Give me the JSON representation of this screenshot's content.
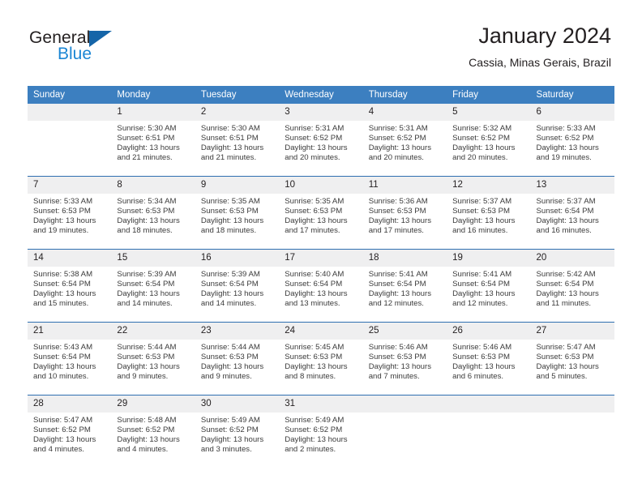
{
  "brand": {
    "name_part1": "General",
    "name_part2": "Blue",
    "triangle_color": "#1565a8",
    "blue_color": "#1b86d4"
  },
  "header": {
    "title": "January 2024",
    "subtitle": "Cassia, Minas Gerais, Brazil"
  },
  "theme": {
    "header_bar_color": "#3c7fc0",
    "row_divider_color": "#2f6fb0",
    "daynum_band_color": "#efeff0"
  },
  "calendar": {
    "weekday_headers": [
      "Sunday",
      "Monday",
      "Tuesday",
      "Wednesday",
      "Thursday",
      "Friday",
      "Saturday"
    ],
    "weeks": [
      [
        {
          "day": "",
          "sunrise": "",
          "sunset": "",
          "daylight_line1": "",
          "daylight_line2": ""
        },
        {
          "day": "1",
          "sunrise": "Sunrise: 5:30 AM",
          "sunset": "Sunset: 6:51 PM",
          "daylight_line1": "Daylight: 13 hours",
          "daylight_line2": "and 21 minutes."
        },
        {
          "day": "2",
          "sunrise": "Sunrise: 5:30 AM",
          "sunset": "Sunset: 6:51 PM",
          "daylight_line1": "Daylight: 13 hours",
          "daylight_line2": "and 21 minutes."
        },
        {
          "day": "3",
          "sunrise": "Sunrise: 5:31 AM",
          "sunset": "Sunset: 6:52 PM",
          "daylight_line1": "Daylight: 13 hours",
          "daylight_line2": "and 20 minutes."
        },
        {
          "day": "4",
          "sunrise": "Sunrise: 5:31 AM",
          "sunset": "Sunset: 6:52 PM",
          "daylight_line1": "Daylight: 13 hours",
          "daylight_line2": "and 20 minutes."
        },
        {
          "day": "5",
          "sunrise": "Sunrise: 5:32 AM",
          "sunset": "Sunset: 6:52 PM",
          "daylight_line1": "Daylight: 13 hours",
          "daylight_line2": "and 20 minutes."
        },
        {
          "day": "6",
          "sunrise": "Sunrise: 5:33 AM",
          "sunset": "Sunset: 6:52 PM",
          "daylight_line1": "Daylight: 13 hours",
          "daylight_line2": "and 19 minutes."
        }
      ],
      [
        {
          "day": "7",
          "sunrise": "Sunrise: 5:33 AM",
          "sunset": "Sunset: 6:53 PM",
          "daylight_line1": "Daylight: 13 hours",
          "daylight_line2": "and 19 minutes."
        },
        {
          "day": "8",
          "sunrise": "Sunrise: 5:34 AM",
          "sunset": "Sunset: 6:53 PM",
          "daylight_line1": "Daylight: 13 hours",
          "daylight_line2": "and 18 minutes."
        },
        {
          "day": "9",
          "sunrise": "Sunrise: 5:35 AM",
          "sunset": "Sunset: 6:53 PM",
          "daylight_line1": "Daylight: 13 hours",
          "daylight_line2": "and 18 minutes."
        },
        {
          "day": "10",
          "sunrise": "Sunrise: 5:35 AM",
          "sunset": "Sunset: 6:53 PM",
          "daylight_line1": "Daylight: 13 hours",
          "daylight_line2": "and 17 minutes."
        },
        {
          "day": "11",
          "sunrise": "Sunrise: 5:36 AM",
          "sunset": "Sunset: 6:53 PM",
          "daylight_line1": "Daylight: 13 hours",
          "daylight_line2": "and 17 minutes."
        },
        {
          "day": "12",
          "sunrise": "Sunrise: 5:37 AM",
          "sunset": "Sunset: 6:53 PM",
          "daylight_line1": "Daylight: 13 hours",
          "daylight_line2": "and 16 minutes."
        },
        {
          "day": "13",
          "sunrise": "Sunrise: 5:37 AM",
          "sunset": "Sunset: 6:54 PM",
          "daylight_line1": "Daylight: 13 hours",
          "daylight_line2": "and 16 minutes."
        }
      ],
      [
        {
          "day": "14",
          "sunrise": "Sunrise: 5:38 AM",
          "sunset": "Sunset: 6:54 PM",
          "daylight_line1": "Daylight: 13 hours",
          "daylight_line2": "and 15 minutes."
        },
        {
          "day": "15",
          "sunrise": "Sunrise: 5:39 AM",
          "sunset": "Sunset: 6:54 PM",
          "daylight_line1": "Daylight: 13 hours",
          "daylight_line2": "and 14 minutes."
        },
        {
          "day": "16",
          "sunrise": "Sunrise: 5:39 AM",
          "sunset": "Sunset: 6:54 PM",
          "daylight_line1": "Daylight: 13 hours",
          "daylight_line2": "and 14 minutes."
        },
        {
          "day": "17",
          "sunrise": "Sunrise: 5:40 AM",
          "sunset": "Sunset: 6:54 PM",
          "daylight_line1": "Daylight: 13 hours",
          "daylight_line2": "and 13 minutes."
        },
        {
          "day": "18",
          "sunrise": "Sunrise: 5:41 AM",
          "sunset": "Sunset: 6:54 PM",
          "daylight_line1": "Daylight: 13 hours",
          "daylight_line2": "and 12 minutes."
        },
        {
          "day": "19",
          "sunrise": "Sunrise: 5:41 AM",
          "sunset": "Sunset: 6:54 PM",
          "daylight_line1": "Daylight: 13 hours",
          "daylight_line2": "and 12 minutes."
        },
        {
          "day": "20",
          "sunrise": "Sunrise: 5:42 AM",
          "sunset": "Sunset: 6:54 PM",
          "daylight_line1": "Daylight: 13 hours",
          "daylight_line2": "and 11 minutes."
        }
      ],
      [
        {
          "day": "21",
          "sunrise": "Sunrise: 5:43 AM",
          "sunset": "Sunset: 6:54 PM",
          "daylight_line1": "Daylight: 13 hours",
          "daylight_line2": "and 10 minutes."
        },
        {
          "day": "22",
          "sunrise": "Sunrise: 5:44 AM",
          "sunset": "Sunset: 6:53 PM",
          "daylight_line1": "Daylight: 13 hours",
          "daylight_line2": "and 9 minutes."
        },
        {
          "day": "23",
          "sunrise": "Sunrise: 5:44 AM",
          "sunset": "Sunset: 6:53 PM",
          "daylight_line1": "Daylight: 13 hours",
          "daylight_line2": "and 9 minutes."
        },
        {
          "day": "24",
          "sunrise": "Sunrise: 5:45 AM",
          "sunset": "Sunset: 6:53 PM",
          "daylight_line1": "Daylight: 13 hours",
          "daylight_line2": "and 8 minutes."
        },
        {
          "day": "25",
          "sunrise": "Sunrise: 5:46 AM",
          "sunset": "Sunset: 6:53 PM",
          "daylight_line1": "Daylight: 13 hours",
          "daylight_line2": "and 7 minutes."
        },
        {
          "day": "26",
          "sunrise": "Sunrise: 5:46 AM",
          "sunset": "Sunset: 6:53 PM",
          "daylight_line1": "Daylight: 13 hours",
          "daylight_line2": "and 6 minutes."
        },
        {
          "day": "27",
          "sunrise": "Sunrise: 5:47 AM",
          "sunset": "Sunset: 6:53 PM",
          "daylight_line1": "Daylight: 13 hours",
          "daylight_line2": "and 5 minutes."
        }
      ],
      [
        {
          "day": "28",
          "sunrise": "Sunrise: 5:47 AM",
          "sunset": "Sunset: 6:52 PM",
          "daylight_line1": "Daylight: 13 hours",
          "daylight_line2": "and 4 minutes."
        },
        {
          "day": "29",
          "sunrise": "Sunrise: 5:48 AM",
          "sunset": "Sunset: 6:52 PM",
          "daylight_line1": "Daylight: 13 hours",
          "daylight_line2": "and 4 minutes."
        },
        {
          "day": "30",
          "sunrise": "Sunrise: 5:49 AM",
          "sunset": "Sunset: 6:52 PM",
          "daylight_line1": "Daylight: 13 hours",
          "daylight_line2": "and 3 minutes."
        },
        {
          "day": "31",
          "sunrise": "Sunrise: 5:49 AM",
          "sunset": "Sunset: 6:52 PM",
          "daylight_line1": "Daylight: 13 hours",
          "daylight_line2": "and 2 minutes."
        },
        {
          "day": "",
          "sunrise": "",
          "sunset": "",
          "daylight_line1": "",
          "daylight_line2": ""
        },
        {
          "day": "",
          "sunrise": "",
          "sunset": "",
          "daylight_line1": "",
          "daylight_line2": ""
        },
        {
          "day": "",
          "sunrise": "",
          "sunset": "",
          "daylight_line1": "",
          "daylight_line2": ""
        }
      ]
    ]
  }
}
